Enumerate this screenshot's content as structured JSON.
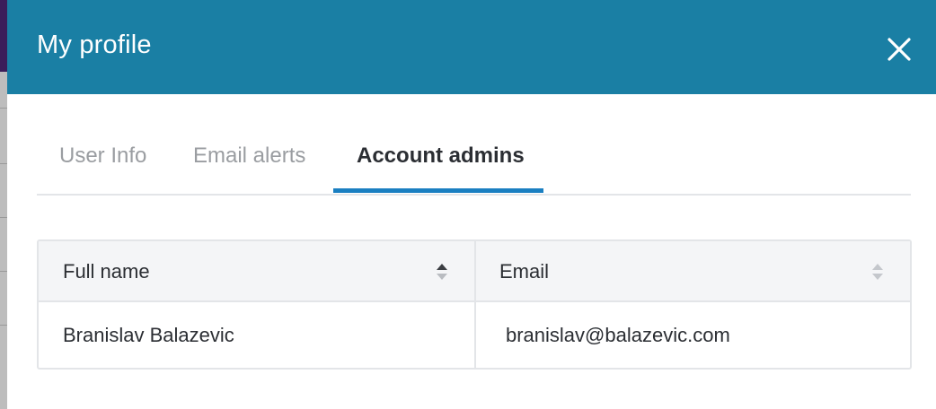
{
  "modal": {
    "title": "My profile",
    "close_icon": "close-icon"
  },
  "tabs": [
    {
      "label": "User Info",
      "active": false
    },
    {
      "label": "Email alerts",
      "active": false
    },
    {
      "label": "Account admins",
      "active": true
    }
  ],
  "table": {
    "columns": [
      {
        "label": "Full name",
        "sort_icon": "sort-icon",
        "sorted": true
      },
      {
        "label": "Email",
        "sort_icon": "sort-icon",
        "sorted": false
      }
    ],
    "rows": [
      {
        "full_name": "Branislav Balazevic",
        "email": "branislav@balazevic.com"
      }
    ]
  },
  "colors": {
    "header_bg": "#1a7fa4",
    "active_tab_underline": "#1a7fc1",
    "table_header_bg": "#f4f5f7",
    "border": "#e3e5e8"
  }
}
